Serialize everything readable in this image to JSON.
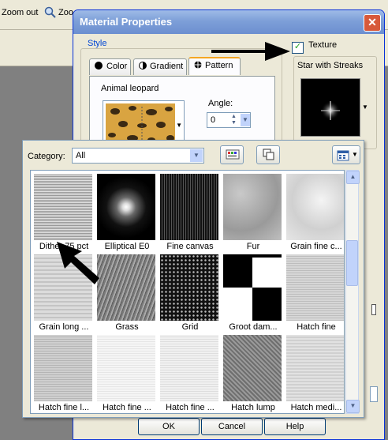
{
  "app": {
    "toolbar": {
      "zoom_out_label": "Zoom out",
      "zoom_in_label": "Zoo"
    }
  },
  "dialog": {
    "title": "Material Properties",
    "style_group_label": "Style",
    "tabs": [
      {
        "label": "Color"
      },
      {
        "label": "Gradient"
      },
      {
        "label": "Pattern"
      }
    ],
    "pattern_name": "Animal leopard",
    "angle_label": "Angle:",
    "angle_value": "0",
    "texture": {
      "label": "Texture",
      "checked": true,
      "name": "Star with Streaks"
    },
    "buttons": {
      "ok": "OK",
      "cancel": "Cancel",
      "help": "Help"
    }
  },
  "popup": {
    "category_label": "Category:",
    "category_value": "All",
    "patterns": [
      {
        "label": "Dither 75 pct",
        "kind": "dither"
      },
      {
        "label": "Elliptical E0",
        "kind": "elliptical"
      },
      {
        "label": "Fine canvas",
        "kind": "finecanvas"
      },
      {
        "label": "Fur",
        "kind": "fur"
      },
      {
        "label": "Grain fine c...",
        "kind": "grainfine"
      },
      {
        "label": "Grain long ...",
        "kind": "grainlong"
      },
      {
        "label": "Grass",
        "kind": "grass"
      },
      {
        "label": "Grid",
        "kind": "grid"
      },
      {
        "label": "Groot dam...",
        "kind": "checker"
      },
      {
        "label": "Hatch fine",
        "kind": "hatchfine"
      },
      {
        "label": "Hatch fine l...",
        "kind": "hatch1"
      },
      {
        "label": "Hatch fine ...",
        "kind": "hatch2"
      },
      {
        "label": "Hatch fine ...",
        "kind": "hatch3"
      },
      {
        "label": "Hatch lump",
        "kind": "hatchlump"
      },
      {
        "label": "Hatch medi...",
        "kind": "hatchmed"
      }
    ]
  }
}
